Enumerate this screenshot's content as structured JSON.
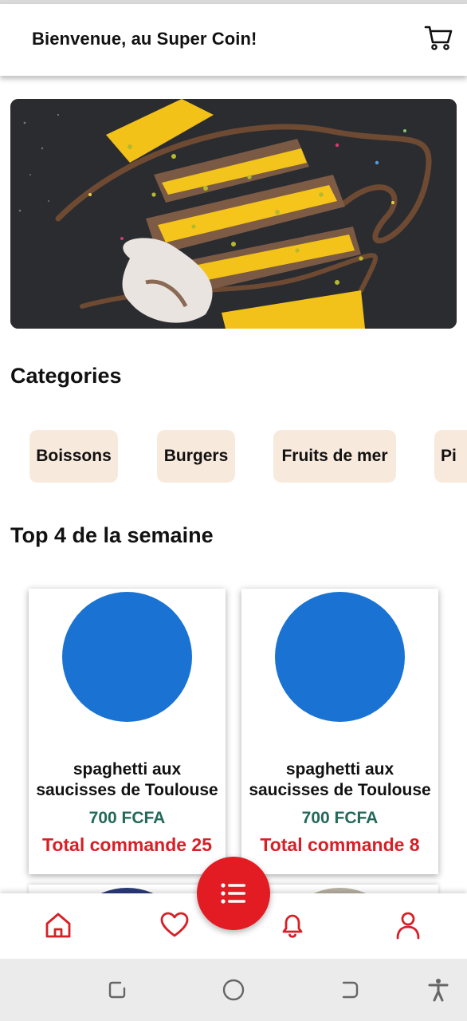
{
  "header": {
    "title": "Bienvenue, au Super Coin!",
    "cart_icon": "cart-icon"
  },
  "hero": {
    "icon": "hero-dessert-image"
  },
  "categories": {
    "title": "Categories",
    "items": [
      {
        "label": "Boissons"
      },
      {
        "label": "Burgers"
      },
      {
        "label": "Fruits de mer"
      },
      {
        "label": "Pi"
      }
    ]
  },
  "top": {
    "title": "Top 4 de la semaine",
    "cards": [
      {
        "name": "spaghetti aux saucisses de Toulouse",
        "price": "700 FCFA",
        "total": "Total commande 25"
      },
      {
        "name": "spaghetti aux saucisses de Toulouse",
        "price": "700 FCFA",
        "total": "Total commande 8"
      }
    ]
  },
  "bottom_nav": {
    "items": [
      {
        "icon": "home-icon"
      },
      {
        "icon": "heart-icon"
      },
      {
        "icon": "bell-icon"
      },
      {
        "icon": "user-icon"
      }
    ],
    "fab_icon": "list-icon"
  },
  "system_nav": {
    "items": [
      {
        "icon": "recents-icon"
      },
      {
        "icon": "home-circle-icon"
      },
      {
        "icon": "back-icon"
      },
      {
        "icon": "accessibility-icon"
      }
    ]
  },
  "colors": {
    "accent_red": "#e31b23",
    "price_green": "#24685a",
    "chip_bg": "#f8e9dd",
    "image_placeholder_blue": "#1a73d2"
  }
}
